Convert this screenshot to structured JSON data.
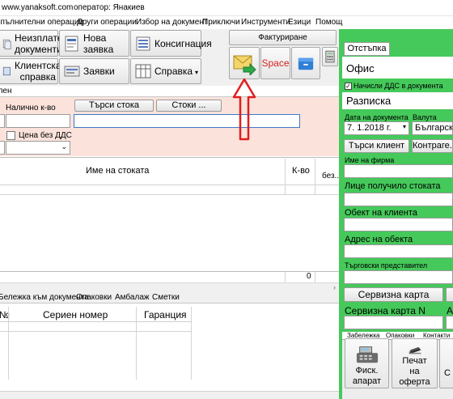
{
  "titlebar": {
    "site": "www.yanaksoft.com",
    "operator": "оператор: Янакиев"
  },
  "menu": [
    "Допълнителни операции",
    "Други операции",
    "Избор на документ",
    "Приключи",
    "Инструменти",
    "Езици",
    "Помощ"
  ],
  "toolbar": {
    "btn_unpaid": "Неизплатени документи",
    "btn_new_request": "Нова заявка",
    "btn_consignment": "Консигнация",
    "btn_client_report": "Клиентска справка",
    "btn_requests": "Заявки",
    "btn_report": "Справка",
    "btn_invoicing": "Фактуриране",
    "btn_space": "Space"
  },
  "filters": {
    "tab_fragment": "пен",
    "available_qty_label": "Налично к-во",
    "search_goods_btn": "Търси стока",
    "goods_btn": "Стоки ...",
    "price_no_vat_label": "Цена без ДДС"
  },
  "goods_table": {
    "col_name": "Име на стоката",
    "col_qty": "К-во",
    "col_no_vat": "без...",
    "footer_total": "0"
  },
  "bottom_tabs": [
    "Бележка към документа",
    "Опаковки",
    "Амбалаж",
    "Сметки"
  ],
  "serial_table": {
    "col_no": "№",
    "col_serial": "Сериен номер",
    "col_warranty": "Гаранция"
  },
  "right": {
    "discount_tab": "Отстъпка",
    "office": "Офис",
    "vat_checkbox": "Начисли ДДС в документа",
    "doc_type": "Разписка",
    "doc_date_label": "Дата на документа",
    "doc_date": "7. 1.2018 г.",
    "currency_label": "Валута",
    "currency": "Българск...",
    "search_client_btn": "Търси клиент",
    "contragent_btn": "Контраге...",
    "company_label": "Име на фирма",
    "receiver_label": "Лице получило стоката",
    "client_object_label": "Обект на клиента",
    "object_address_label": "Адрес на обекта",
    "sales_rep_label": "Търговски представител",
    "service_card_btn": "Сервизна карта",
    "service_card_n_label": "Сервизна карта N",
    "small_tabs": [
      "Забележка",
      "Опаковки",
      "Контакти"
    ],
    "fiscal_btn": "Фиск. апарат",
    "print_offer_btn": "Печат на оферта",
    "partial_a": "А",
    "partial_c": "С"
  },
  "colors": {
    "accent_green": "#45c95a",
    "pink_bar": "#fbe3dc",
    "red_arrow": "#e01e1e"
  }
}
